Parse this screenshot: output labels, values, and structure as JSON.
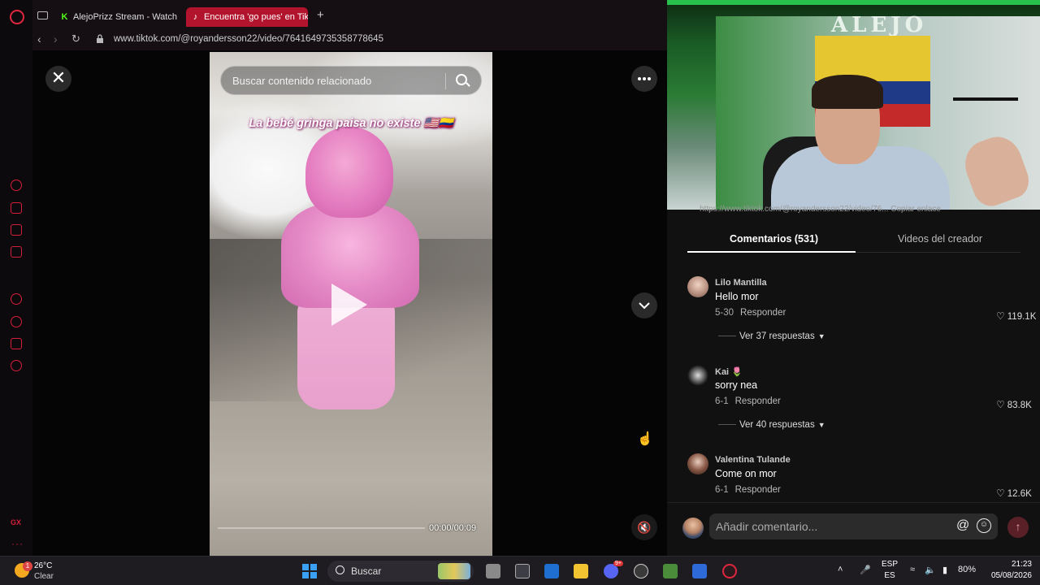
{
  "browser": {
    "tabs": [
      {
        "label": "AlejoPrizz Stream - Watch Li",
        "favicon": "kick-icon",
        "active": false
      },
      {
        "label": "Encuentra 'go pues' en TikTo",
        "favicon": "tiktok-icon",
        "active": true
      }
    ],
    "new_tab_symbol": "+",
    "url": "www.tiktok.com/@royandersson22/video/7641649735358778645",
    "accent_color": "#d41f3a"
  },
  "sidebar": {
    "gx_label": "GX",
    "more_label": "···"
  },
  "video": {
    "search_placeholder": "Buscar contenido relacionado",
    "overlay_text": "La bebé gringa paisa no existe 🇺🇸🇨🇴",
    "time": "00:00/00:09",
    "close_symbol": "✕",
    "mute_symbol": "🔇"
  },
  "comments_panel": {
    "clipped_link_text": "https://www.tiktok.com/@royandersson22/video/76... Copiar enlace",
    "tabs": [
      {
        "label": "Comentarios (531)",
        "active": true
      },
      {
        "label": "Videos del creador",
        "active": false
      }
    ],
    "comments": [
      {
        "user": "Lilo Mantilla",
        "text": "Hello mor",
        "date": "5-30",
        "reply_label": "Responder",
        "likes": "119.1K",
        "replies_label": "Ver 37 respuestas"
      },
      {
        "user": "Kai 🌷",
        "text": "sorry nea",
        "date": "6-1",
        "reply_label": "Responder",
        "likes": "83.8K",
        "replies_label": "Ver 40 respuestas"
      },
      {
        "user": "Valentina Tulande",
        "text": "Come on mor",
        "date": "6-1",
        "reply_label": "Responder",
        "likes": "12.6K",
        "replies_label": ""
      }
    ],
    "input_placeholder": "Añadir comentario...",
    "at_symbol": "@",
    "emoji_symbol": "☺",
    "send_symbol": "↑"
  },
  "webcam": {
    "wall_text": "ALEJO"
  },
  "taskbar": {
    "weather_temp": "26°C",
    "weather_desc": "Clear",
    "weather_badge": "1",
    "search_placeholder": "Buscar",
    "lang_primary": "ESP",
    "lang_secondary": "ES",
    "battery": "80%",
    "time": "21:23",
    "date": "05/08/2026",
    "discord_badge": "9+"
  }
}
